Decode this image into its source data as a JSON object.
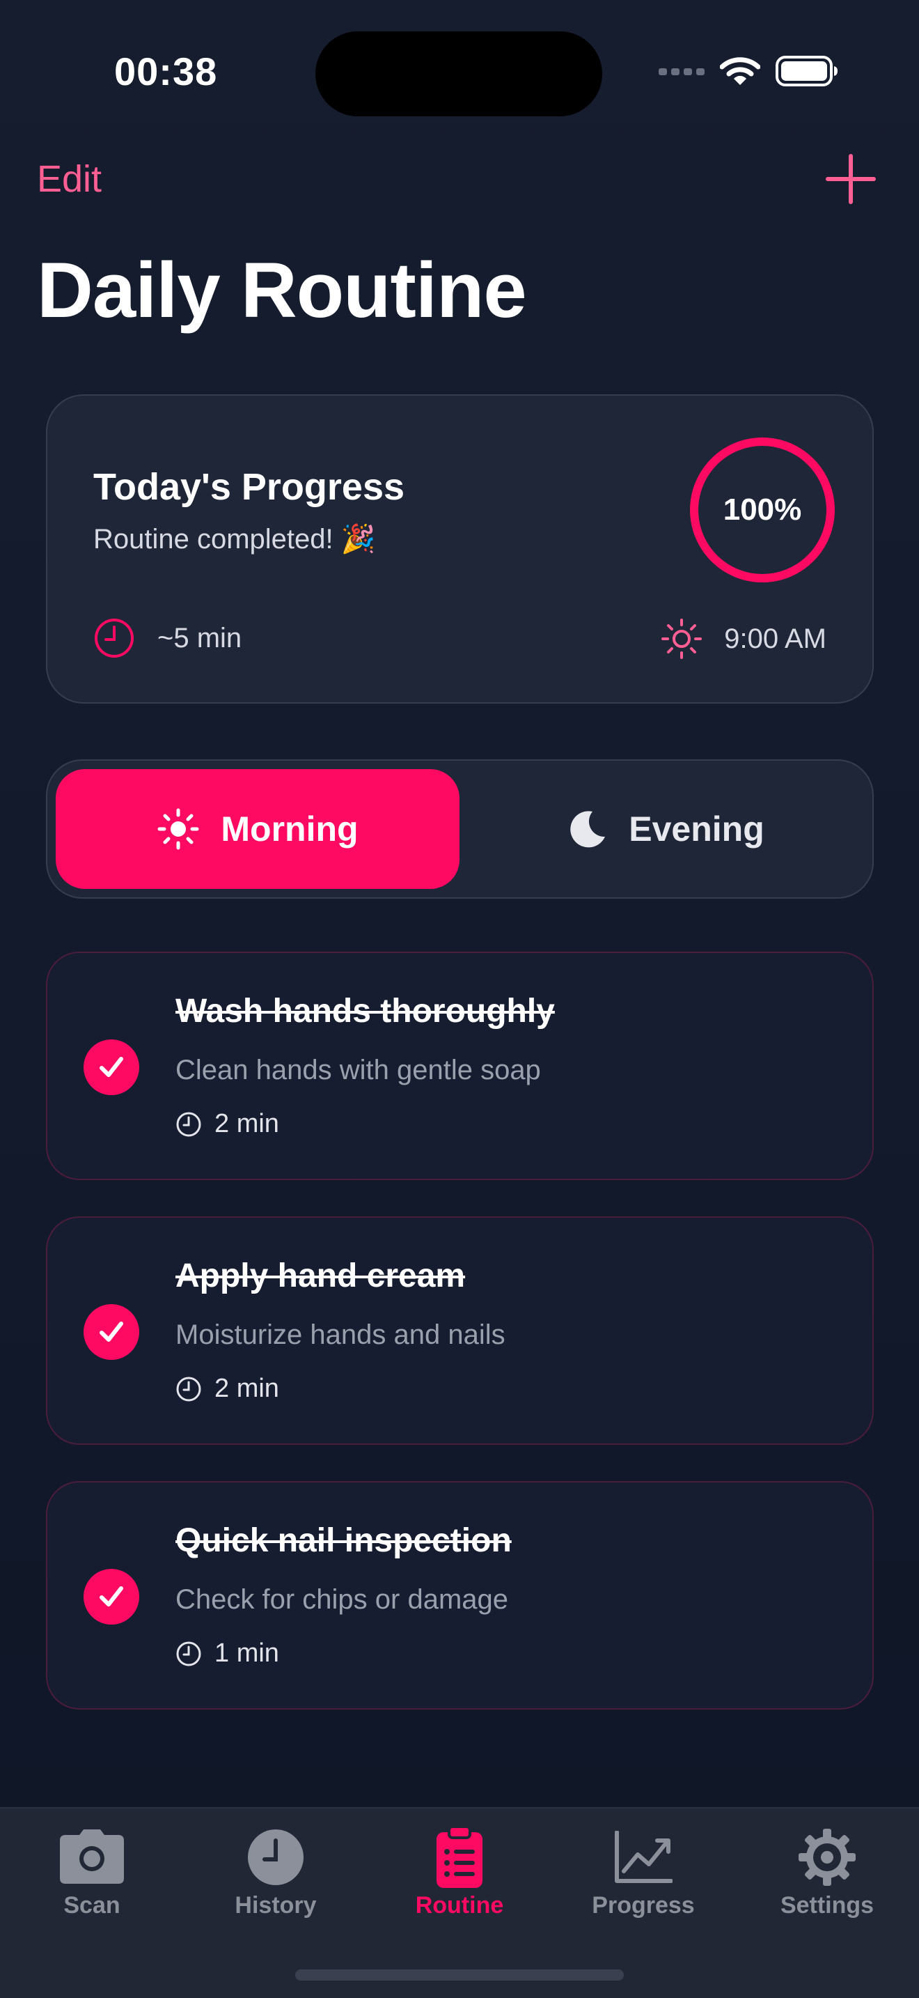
{
  "status_bar": {
    "time": "00:38"
  },
  "nav": {
    "edit_label": "Edit",
    "title": "Daily Routine"
  },
  "progress_card": {
    "title": "Today's Progress",
    "subtitle": "Routine completed! 🎉",
    "percent_label": "100%",
    "percent_value": 100,
    "duration": "~5 min",
    "time": "9:00 AM"
  },
  "segments": {
    "morning": "Morning",
    "evening": "Evening",
    "selected": "Morning"
  },
  "tasks": [
    {
      "title": "Wash hands thoroughly",
      "description": "Clean hands with gentle soap",
      "duration": "2 min",
      "done": true
    },
    {
      "title": "Apply hand cream",
      "description": "Moisturize hands and nails",
      "duration": "2 min",
      "done": true
    },
    {
      "title": "Quick nail inspection",
      "description": "Check for chips or damage",
      "duration": "1 min",
      "done": true
    }
  ],
  "tabbar": {
    "tabs": [
      {
        "label": "Scan",
        "icon": "camera-icon"
      },
      {
        "label": "History",
        "icon": "clock-icon"
      },
      {
        "label": "Routine",
        "icon": "clipboard-list-icon",
        "active": true
      },
      {
        "label": "Progress",
        "icon": "chart-trend-icon"
      },
      {
        "label": "Settings",
        "icon": "gear-icon"
      }
    ]
  },
  "colors": {
    "accent": "#ff0a63",
    "accent_light": "#ff5f92",
    "background": "#141b2d",
    "card": "#1f2638"
  }
}
